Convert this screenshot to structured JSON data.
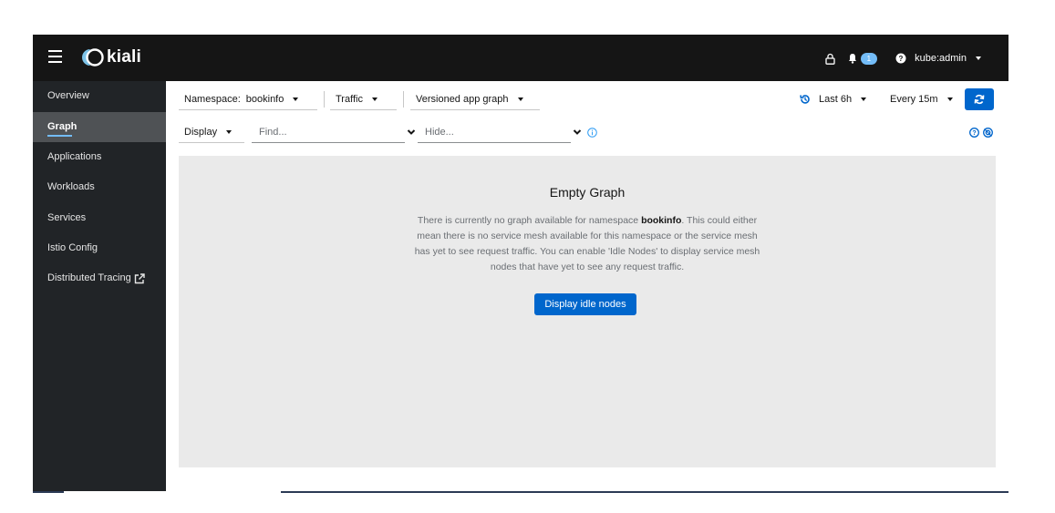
{
  "header": {
    "brand": "kiali",
    "notification_count": "1",
    "user": "kube:admin"
  },
  "sidebar": {
    "items": [
      {
        "label": "Overview"
      },
      {
        "label": "Graph"
      },
      {
        "label": "Applications"
      },
      {
        "label": "Workloads"
      },
      {
        "label": "Services"
      },
      {
        "label": "Istio Config"
      },
      {
        "label": "Distributed Tracing"
      }
    ],
    "active": "Graph"
  },
  "toolbar": {
    "namespace_label": "Namespace:",
    "namespace_value": "bookinfo",
    "traffic_label": "Traffic",
    "graph_type": "Versioned app graph",
    "duration": "Last 6h",
    "refresh_interval": "Every 15m",
    "display_label": "Display",
    "find_placeholder": "Find...",
    "hide_placeholder": "Hide..."
  },
  "empty_state": {
    "title": "Empty Graph",
    "body_prefix": "There is currently no graph available for namespace ",
    "namespace": "bookinfo",
    "body_suffix": ". This could either mean there is no service mesh available for this namespace or the service mesh has yet to see request traffic. You can enable 'Idle Nodes' to display service mesh nodes that have yet to see any request traffic.",
    "button_label": "Display idle nodes"
  },
  "colors": {
    "masthead": "#151515",
    "sidebar": "#212427",
    "sidebar_active": "#4f5255",
    "accent": "#0066cc",
    "badge": "#73bcf7",
    "empty_bg": "#eaeaea"
  }
}
